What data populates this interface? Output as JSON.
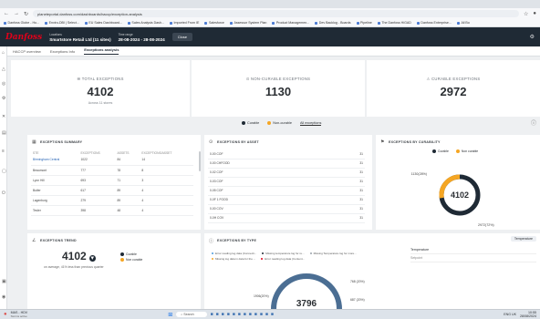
{
  "browser": {
    "url": "planeteportal.danfoss.com/dashboards/haccp/exception-analysis",
    "bookmarks": [
      "Danfoss Globe - Ho...",
      "Enviro-DBI | Select...",
      "EU Sales Dashboard...",
      "Sales Analysis Dash...",
      "Imported From IE",
      "Salesforce",
      "Assessor System Plan",
      "Product Managemen...",
      "Dev Backlog - Boards",
      "Pipeline",
      "The Danfoss HiGAD",
      "Danfoss Enterprise...",
      "All Bo"
    ]
  },
  "header": {
    "brand": "Danfoss",
    "location_label": "Locations",
    "location_value": "Smartstore Retail Ltd (11 sites)",
    "timerange_label": "Time range",
    "timerange_value": "28-08-2024 - 28-08-2024",
    "close_label": "Close"
  },
  "tabs": [
    "HACCP overview",
    "Exceptions Info",
    "Exceptions analysis"
  ],
  "kpis": [
    {
      "label": "TOTAL EXCEPTIONS",
      "value": "4102",
      "sub": "Across 11 stores"
    },
    {
      "label": "NON-CURABLE EXCEPTIONS",
      "value": "1130",
      "sub": ""
    },
    {
      "label": "CURABLE EXCEPTIONS",
      "value": "2972",
      "sub": ""
    }
  ],
  "legend": {
    "curable": "Curable",
    "non_curable": "Non-curable",
    "all": "All exceptions"
  },
  "colors": {
    "curable": "#1f2a35",
    "non_curable": "#f5a623",
    "accent": "#e1001a"
  },
  "summary": {
    "title": "EXCEPTIONS SUMMARY",
    "headers": [
      "STE",
      "EXCEPTIONS",
      "ASSETS",
      "EXCEPTIONS/ASSET"
    ],
    "rows": [
      [
        "Birmingham Central",
        "1022",
        "84",
        "14"
      ],
      [
        "Beaumont",
        "777",
        "78",
        "8"
      ],
      [
        "Lyon Hill",
        "693",
        "71",
        "3"
      ],
      [
        "Butler",
        "617",
        "89",
        "4"
      ],
      [
        "Lagenburg",
        "279",
        "89",
        "4"
      ],
      [
        "Tesler",
        "398",
        "48",
        "4"
      ]
    ]
  },
  "by_asset": {
    "title": "EXCEPTIONS BY ASSET",
    "rows": [
      [
        "0-00 COF",
        "31"
      ],
      [
        "0-00 CHFOOD",
        "31"
      ],
      [
        "0-02 COF",
        "31"
      ],
      [
        "0-03 COF",
        "31"
      ],
      [
        "0-05 COF",
        "31"
      ],
      [
        "0-0F 1 FOOD",
        "31"
      ],
      [
        "0-00 COV",
        "31"
      ],
      [
        "0-0H COV",
        "31"
      ]
    ]
  },
  "by_curability": {
    "title": "EXCEPTIONS BY CURABILITY",
    "legend": [
      "Curable",
      "Non curable"
    ],
    "center": "4102",
    "label_nc": "1130(28%)",
    "label_c": "2972(72%)"
  },
  "chart_data": {
    "type": "pie",
    "title": "EXCEPTIONS BY CURABILITY",
    "categories": [
      "Curable",
      "Non curable"
    ],
    "values": [
      2972,
      1130
    ]
  },
  "trend": {
    "title": "EXCEPTIONS TREND",
    "value": "4102",
    "sub": "on average, 41% less than previous quarter",
    "legend": [
      "Curable",
      "Non curable"
    ]
  },
  "by_type": {
    "title": "EXCEPTIONS BY TYPE",
    "legend": [
      "Error reading log data (Connecti...",
      "Missing temperature log for re...",
      "Missing Temperature log for more...",
      "Missing log data in data for the ...",
      "Error reading log data (Content..."
    ],
    "center": "3796",
    "labels": [
      "1906(20%)",
      "768 (20%)",
      "687 (20%)"
    ],
    "sidebar": [
      {
        "name": "Temperature",
        "value": ""
      },
      {
        "name": "Setpoint",
        "value": ""
      }
    ],
    "tag": "Temperature"
  },
  "taskbar": {
    "weather": "MAS - HDV",
    "weather_sub": "Storms active",
    "search": "Search",
    "time": "10:55",
    "date": "28/08/2024",
    "lang": "ENG UK"
  }
}
